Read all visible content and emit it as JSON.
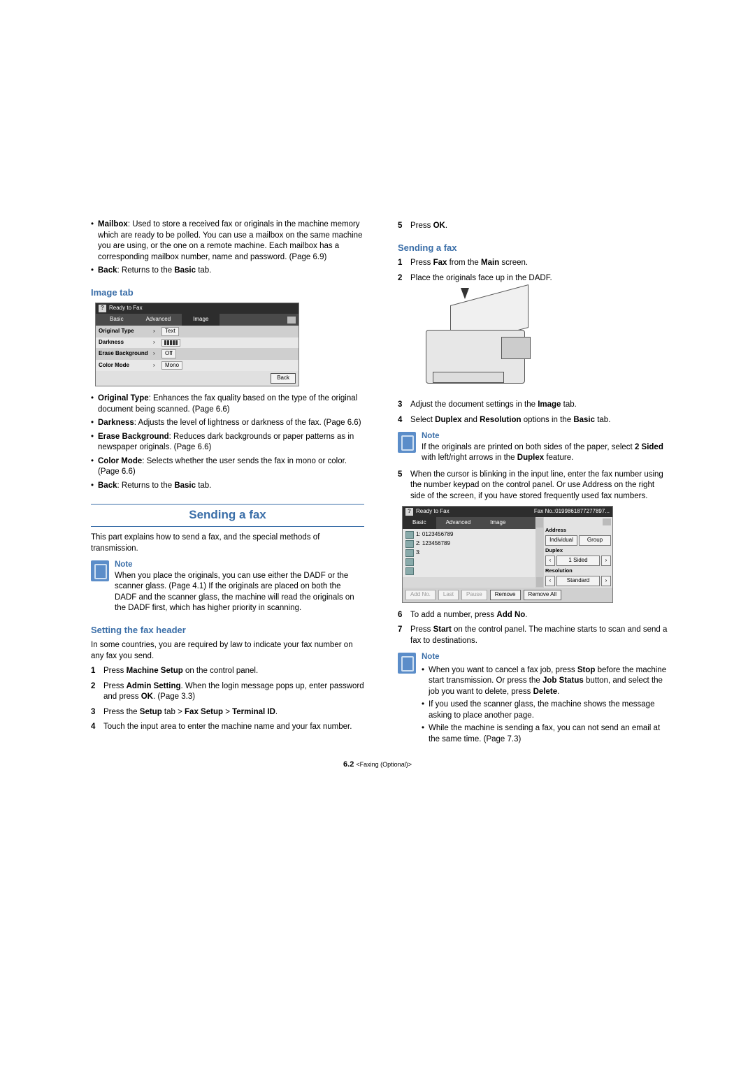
{
  "left": {
    "intro_bullets": [
      {
        "term": "Mailbox",
        "text": ": Used to store a received fax or originals in the machine memory which are ready to be polled. You can use a mailbox on the same machine you are using, or the one on a remote machine. Each mailbox has a corresponding mailbox number, name and password. (Page 6.9)"
      },
      {
        "term": "Back",
        "text": ": Returns to the ",
        "term2": "Basic",
        "text2": " tab."
      }
    ],
    "image_tab_heading": "Image tab",
    "ui1": {
      "title": "Ready to Fax",
      "tabs": {
        "basic": "Basic",
        "advanced": "Advanced",
        "image": "Image"
      },
      "rows": {
        "original_type": {
          "label": "Original Type",
          "value": "Text"
        },
        "darkness": {
          "label": "Darkness"
        },
        "erase_bg": {
          "label": "Erase Background",
          "value": "Off"
        },
        "color_mode": {
          "label": "Color Mode",
          "value": "Mono"
        }
      },
      "back": "Back"
    },
    "image_tab_bullets": [
      {
        "term": "Original Type",
        "text": ": Enhances the fax quality based on the type of the original document being scanned. (Page 6.6)"
      },
      {
        "term": "Darkness",
        "text": ": Adjusts the level of lightness or darkness of the fax. (Page 6.6)"
      },
      {
        "term": "Erase Background",
        "text": ": Reduces dark backgrounds or paper patterns as in newspaper originals. (Page 6.6)"
      },
      {
        "term": "Color Mode",
        "text": ": Selects whether the user sends the fax in mono or color. (Page 6.6)"
      },
      {
        "term": "Back",
        "text": ": Returns to the ",
        "term2": "Basic",
        "text2": " tab."
      }
    ],
    "section_title": "Sending a fax",
    "section_intro": "This part explains how to send a fax, and the special methods of transmission.",
    "note_label": "Note",
    "note_text": "When you place the originals, you can use either the DADF or the scanner glass. (Page 4.1) If the originals are placed on both the DADF and the scanner glass, the machine will read the originals on the DADF first, which has higher priority in scanning.",
    "setting_header_heading": "Setting the fax header",
    "setting_header_intro": "In some countries, you are required by law to indicate your fax number on any fax you send.",
    "steps": {
      "1": {
        "pre": "Press ",
        "b1": "Machine Setup",
        "post": " on the control panel."
      },
      "2": {
        "pre": "Press ",
        "b1": "Admin Setting",
        "mid": ". When the login message pops up, enter password and press ",
        "b2": "OK",
        "post": ". (Page 3.3)"
      },
      "3": {
        "pre": "Press the ",
        "b1": "Setup",
        "mid1": " tab > ",
        "b2": "Fax Setup",
        "mid2": " > ",
        "b3": "Terminal ID",
        "post": "."
      },
      "4": {
        "text": "Touch the input area to enter the machine name and your fax number."
      }
    }
  },
  "right": {
    "step5": {
      "num": "5",
      "pre": "Press ",
      "b1": "OK",
      "post": "."
    },
    "sending_heading": "Sending a fax",
    "steps_a": {
      "1": {
        "pre": "Press ",
        "b1": "Fax",
        "mid": " from the ",
        "b2": "Main",
        "post": " screen."
      },
      "2": {
        "text": "Place the originals face up in the DADF."
      }
    },
    "steps_b": {
      "3": {
        "pre": "Adjust the document settings in the ",
        "b1": "Image",
        "post": " tab."
      },
      "4": {
        "pre": "Select ",
        "b1": "Duplex",
        "mid": " and ",
        "b2": "Resolution",
        "mid2": " options in the ",
        "b3": "Basic",
        "post": " tab."
      }
    },
    "note1_label": "Note",
    "note1_line": {
      "pre": "If the originals are printed on both sides of the paper, select ",
      "b1": "2 Sided",
      "mid": " with left/right arrows in the ",
      "b2": "Duplex",
      "post": " feature."
    },
    "step5b": {
      "num": "5",
      "text": "When the cursor is blinking in the input line, enter the fax number using the number keypad on the control panel. Or use Address on the right side of the screen, if you have stored frequently used fax numbers."
    },
    "ui2": {
      "title": "Ready to Fax",
      "faxno": "Fax No.:0199861877277897...",
      "tabs": {
        "basic": "Basic",
        "advanced": "Advanced",
        "image": "Image"
      },
      "list": {
        "r1": "1: 0123456789",
        "r2": "2: 123456789",
        "r3": "3:"
      },
      "panel": {
        "address": "Address",
        "individual": "Individual",
        "group": "Group",
        "duplex": "Duplex",
        "onesided": "1 Sided",
        "resolution": "Resolution",
        "standard": "Standard"
      },
      "footer": {
        "addno": "Add No.",
        "last": "Last",
        "pause": "Pause",
        "remove": "Remove",
        "removeall": "Remove All"
      }
    },
    "step6": {
      "num": "6",
      "pre": "To add a number, press ",
      "b1": "Add No",
      "post": "."
    },
    "step7": {
      "num": "7",
      "pre": "Press ",
      "b1": "Start",
      "post": " on the control panel. The machine starts to scan and send a fax to destinations."
    },
    "note2_label": "Note",
    "note2_bullets": {
      "0": {
        "pre": "When you want to cancel a fax job, press ",
        "b1": "Stop",
        "mid1": " before the machine start transmission. Or press the ",
        "b2": "Job Status",
        "mid2": " button, and select the job you want to delete, press ",
        "b3": "Delete",
        "post": "."
      },
      "1": {
        "text": "If you used the scanner glass, the machine shows the message asking to place another page."
      },
      "2": {
        "text": "While the machine is sending a fax, you can not send an email at the same time. (Page 7.3)"
      }
    }
  },
  "footer": {
    "page": "6.2",
    "section": "<Faxing (Optional)>"
  }
}
